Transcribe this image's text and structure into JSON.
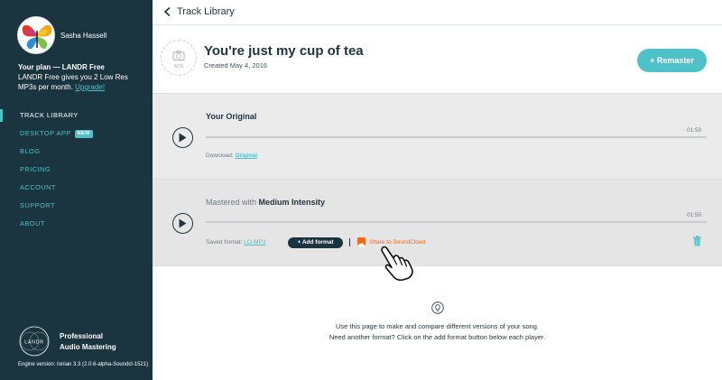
{
  "user": {
    "name": "Sasha Hassell",
    "plan_title": "Your plan  — LANDR Free",
    "plan_desc": "LANDR Free gives you 2 Low Res MP3s per month.",
    "upgrade_label": "Upgrade!"
  },
  "nav": {
    "track_library": "TRACK LIBRARY",
    "desktop_app": "DESKTOP APP",
    "new_badge": "NEW",
    "blog": "BLOG",
    "pricing": "PRICING",
    "account": "ACCOUNT",
    "support": "SUPPORT",
    "about": "ABOUT"
  },
  "brand": {
    "logo_text": "LANDR",
    "line1": "Professional",
    "line2": "Audio Mastering",
    "engine": "Engine version: Ionian 3.3 (2.0.6-alpha-Soundcl-1521)"
  },
  "header": {
    "back_label": "Track Library"
  },
  "song": {
    "cover_add_label": "ADD",
    "title": "You're just my cup of tea",
    "created": "Created May 4, 2016",
    "remaster_label": "+ Remaster"
  },
  "original": {
    "title": "Your Original",
    "duration": "01:50",
    "download_label": "Download:",
    "download_link": "Original"
  },
  "mastered": {
    "prefix": "Mastered with",
    "intensity": "Medium Intensity",
    "duration": "01:50",
    "saved_format_label": "Saved format:",
    "saved_format_value": "LO-MP3",
    "add_format_label": "+ Add format",
    "share_label": "Share to SoundCloud"
  },
  "help": {
    "line1": "Use this page to make and compare different versions of your song.",
    "line2": "Need another format? Click on the add format button below each player."
  },
  "colors": {
    "sidebar_bg": "#1a3440",
    "accent": "#4fc1c8",
    "soundcloud": "#f26a1b",
    "panel_bg": "#ebebeb"
  },
  "icons": [
    "avatar-butterfly",
    "chevron-left-icon",
    "camera-icon",
    "play-icon",
    "soundcloud-icon",
    "trash-icon",
    "hand-cursor-icon",
    "lightbulb-icon",
    "landr-logo"
  ]
}
